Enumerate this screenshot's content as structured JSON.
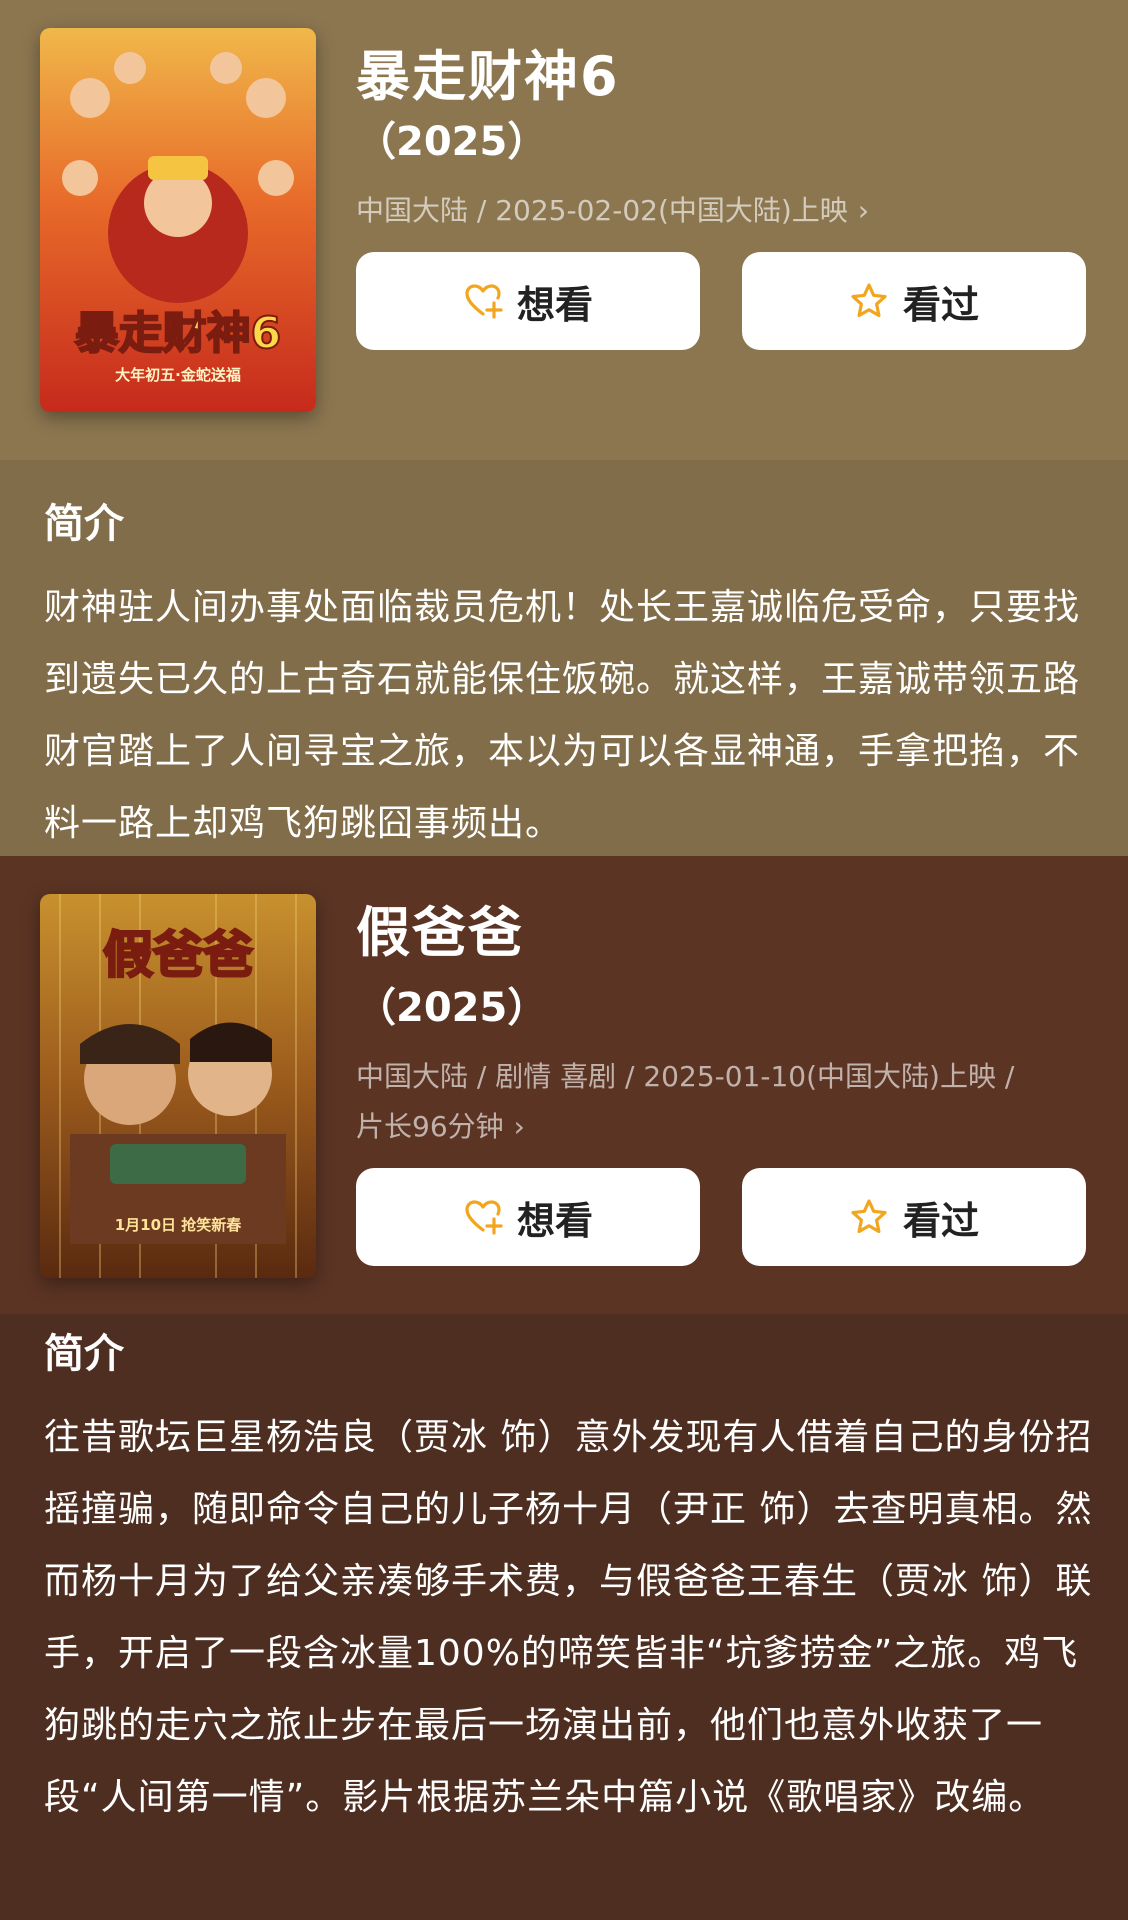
{
  "movies": [
    {
      "title": "暴走财神6",
      "year": "（2025）",
      "meta": "中国大陆 / 2025-02-02(中国大陆)上映",
      "meta2": "",
      "want_label": "想看",
      "seen_label": "看过",
      "intro_heading": "简介",
      "intro": "财神驻人间办事处面临裁员危机！处长王嘉诚临危受命，只要找到遗失已久的上古奇石就能保住饭碗。就这样，王嘉诚带领五路财官踏上了人间寻宝之旅，本以为可以各显神通，手拿把掐，不料一路上却鸡飞狗跳囧事频出。",
      "poster_text": "暴走财神6",
      "poster_sub": "大年初五·金蛇送福"
    },
    {
      "title": "假爸爸",
      "year": "（2025）",
      "meta": "中国大陆 / 剧情 喜剧 / 2025-01-10(中国大陆)上映 /",
      "meta2": "片长96分钟",
      "want_label": "想看",
      "seen_label": "看过",
      "intro_heading": "简介",
      "intro": "往昔歌坛巨星杨浩良（贾冰 饰）意外发现有人借着自己的身份招摇撞骗，随即命令自己的儿子杨十月（尹正 饰）去查明真相。然而杨十月为了给父亲凑够手术费，与假爸爸王春生（贾冰 饰）联手，开启了一段含冰量100%的啼笑皆非“坑爹捞金”之旅。鸡飞狗跳的走穴之旅止步在最后一场演出前，他们也意外收获了一段“人间第一情”。影片根据苏兰朵中篇小说《歌唱家》改编。",
      "poster_text": "假爸爸",
      "poster_sub": "1月10日 抢笑新春"
    }
  ],
  "icons": {
    "want": "heart-plus-icon",
    "seen": "star-icon",
    "more": "chevron-right-icon"
  },
  "colors": {
    "accent": "#f2a51e"
  }
}
